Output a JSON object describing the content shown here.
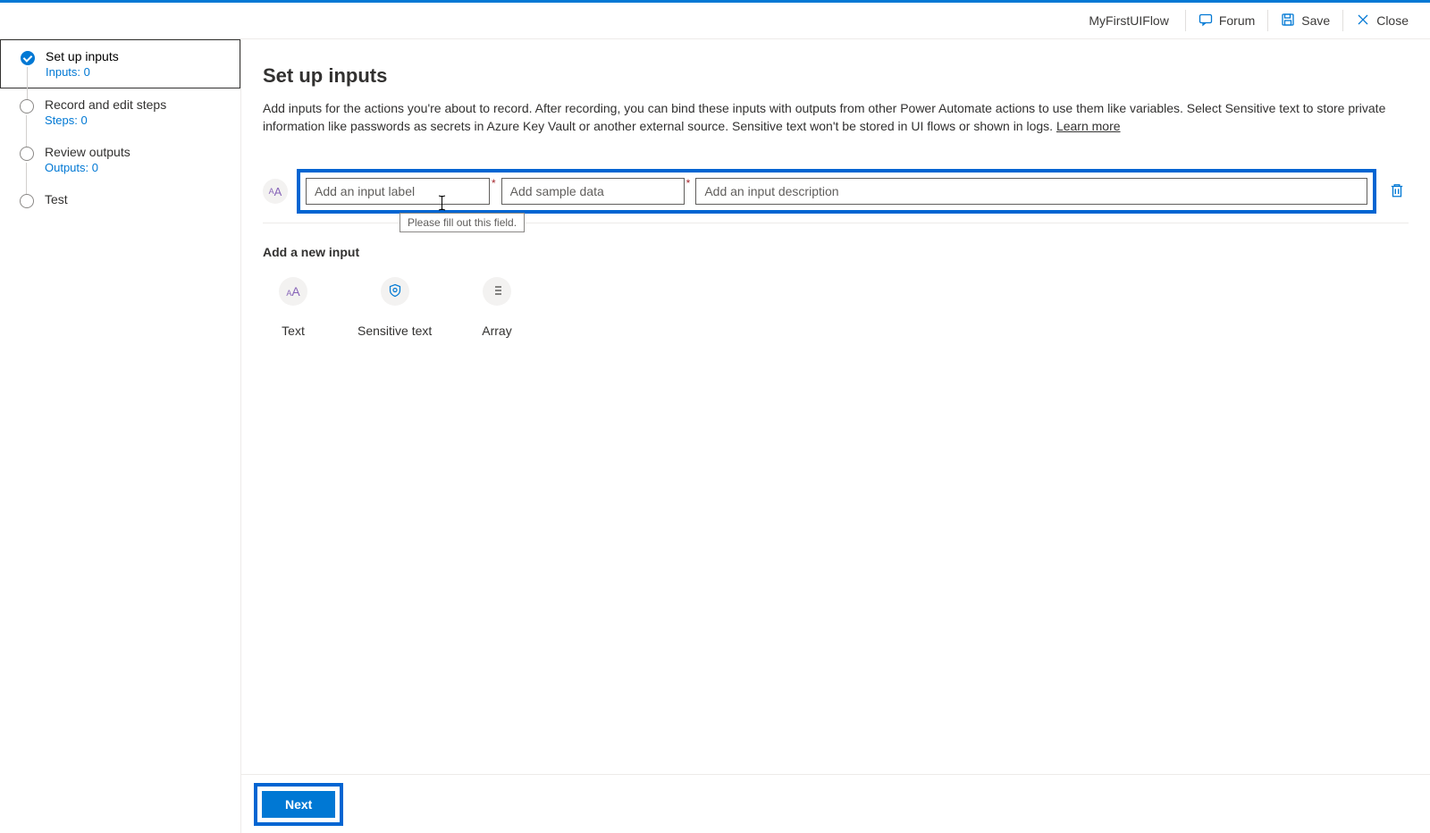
{
  "header": {
    "flowName": "MyFirstUIFlow",
    "forum": "Forum",
    "save": "Save",
    "close": "Close"
  },
  "sidebar": {
    "steps": [
      {
        "title": "Set up inputs",
        "sub": "Inputs: 0"
      },
      {
        "title": "Record and edit steps",
        "sub": "Steps: 0"
      },
      {
        "title": "Review outputs",
        "sub": "Outputs: 0"
      },
      {
        "title": "Test",
        "sub": ""
      }
    ]
  },
  "main": {
    "title": "Set up inputs",
    "intro": "Add inputs for the actions you're about to record. After recording, you can bind these inputs with outputs from other Power Automate actions to use them like variables. Select Sensitive text to store private information like passwords as secrets in Azure Key Vault or another external source. Sensitive text won't be stored in UI flows or shown in logs. ",
    "learnMore": "Learn more",
    "tooltip": "Please fill out this field.",
    "fields": {
      "labelPlaceholder": "Add an input label",
      "samplePlaceholder": "Add sample data",
      "descPlaceholder": "Add an input description"
    },
    "addSection": "Add a new input",
    "types": {
      "text": "Text",
      "sensitive": "Sensitive text",
      "array": "Array"
    },
    "next": "Next"
  }
}
